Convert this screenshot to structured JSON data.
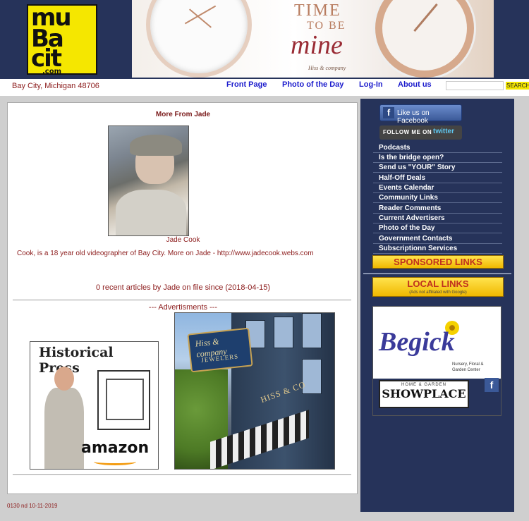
{
  "header": {
    "logo": {
      "line1": "mu",
      "line2": "Ba",
      "line3": "cit",
      "line4": ".com"
    },
    "banner": {
      "line1": "TIME",
      "line2": "TO BE",
      "line3": "mine",
      "brand": "Hiss & company"
    }
  },
  "navbar": {
    "location": "Bay City, Michigan 48706",
    "links": [
      "Front Page",
      "Photo of the Day",
      "Log-In",
      "About us"
    ],
    "search": {
      "placeholder": "",
      "button": "SEARCH"
    }
  },
  "main": {
    "heading": "More From Jade",
    "author_name": "Jade Cook",
    "author_bio": "Cook, is a 18 year old videographer of Bay City. More on Jade - http://www.jadecook.webs.com",
    "articles_count": "0 recent articles by Jade on file since (2018-04-15)",
    "ads_label": "--- Advertisments ---",
    "ad_historical": {
      "title": "Historical Press",
      "brand": "amazon"
    },
    "ad_jewelers": {
      "sign": "Hiss & company",
      "sign_sub": "JEWELERS",
      "storefront": "HISS & CO"
    }
  },
  "footer": {
    "code": "0130 nd 10-11-2019"
  },
  "sidebar": {
    "facebook": "Like us on Facebook",
    "twitter": "FOLLOW ME ON",
    "twitter_brand": "twitter",
    "links": [
      "Podcasts",
      "Is the bridge open?",
      "Send us \"YOUR\" Story",
      "Half-Off Deals",
      "Events Calendar",
      "Community Links",
      "Reader Comments",
      "Current Advertisers",
      "Photo of the Day",
      "Government Contacts",
      "Subscriptionn Services"
    ],
    "sponsored": "SPONSORED LINKS",
    "local": "LOCAL LINKS",
    "local_note": "(Ads not affiliated with Google)",
    "begick": {
      "logo": "Begick",
      "sub1": "Nursery, Floral &",
      "sub2": "Garden Center",
      "show1": "HOME & GARDEN",
      "show2": "SHOWPLACE"
    }
  },
  "colors": {
    "header_bg": "#26335a",
    "link_blue": "#1a1acc",
    "text_maroon": "#8b1a1a",
    "logo_yellow": "#f5e700",
    "sponsored_red": "#c0301e"
  }
}
